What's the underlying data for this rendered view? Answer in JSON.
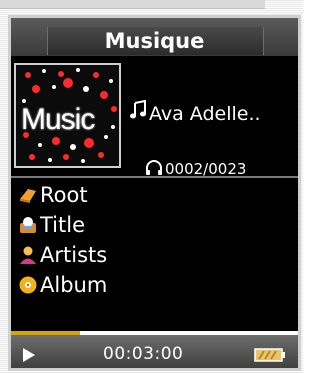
{
  "title": "Musique",
  "album_art": {
    "text": "Music"
  },
  "now_playing": {
    "artist": "Ava Adelle..",
    "track_counter": "0002/0023"
  },
  "menu": [
    {
      "label": "Root",
      "icon": "folder-icon"
    },
    {
      "label": "Title",
      "icon": "title-icon"
    },
    {
      "label": "Artists",
      "icon": "artist-icon"
    },
    {
      "label": "Album",
      "icon": "album-disc-icon"
    }
  ],
  "playback": {
    "time": "00:03:00",
    "progress": 0.24
  },
  "colors": {
    "accent": "#d7a400",
    "background": "#000000"
  }
}
